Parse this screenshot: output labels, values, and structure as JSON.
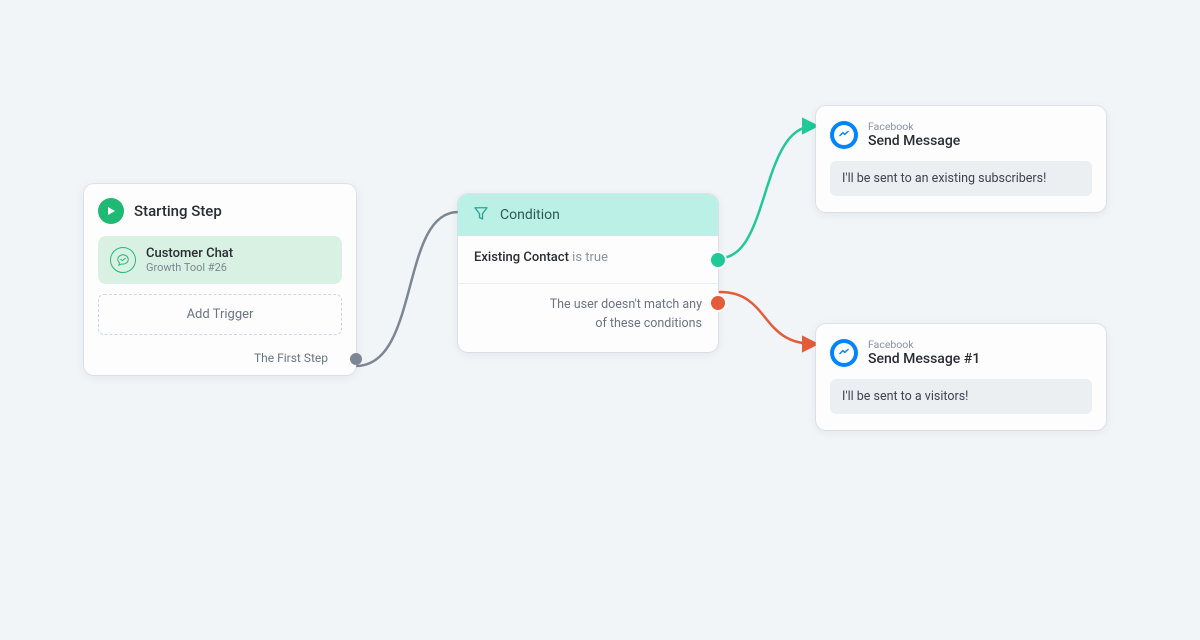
{
  "starting": {
    "title": "Starting Step",
    "trigger": {
      "name": "Customer Chat",
      "subtitle": "Growth Tool #26"
    },
    "add_trigger_label": "Add Trigger",
    "first_step_label": "The First Step"
  },
  "condition": {
    "title": "Condition",
    "match": {
      "field": "Existing Contact",
      "suffix": "is true"
    },
    "no_match_line1": "The user doesn't match any",
    "no_match_line2": "of these conditions"
  },
  "message_a": {
    "channel": "Facebook",
    "title": "Send Message",
    "body": "I'll be sent to an existing subscribers!"
  },
  "message_b": {
    "channel": "Facebook",
    "title": "Send Message #1",
    "body": "I'll be sent to a visitors!"
  }
}
